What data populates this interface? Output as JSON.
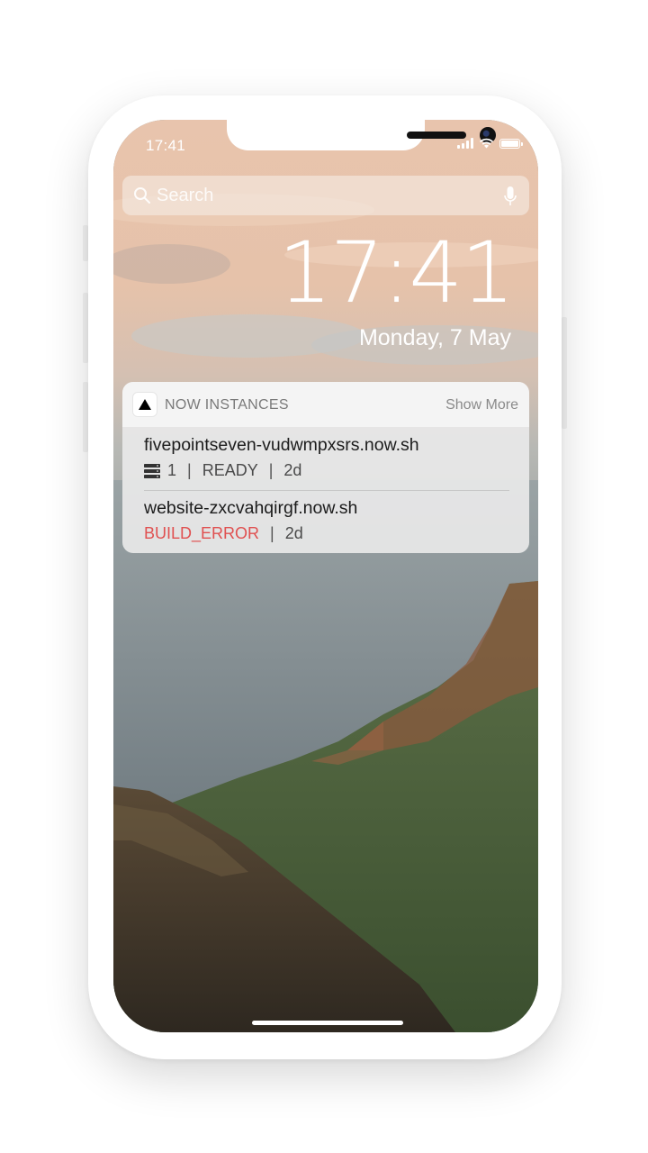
{
  "status_bar": {
    "time": "17:41"
  },
  "search": {
    "placeholder": "Search"
  },
  "lockscreen": {
    "clock": "17:41",
    "date": "Monday, 7 May"
  },
  "notification": {
    "app_name": "NOW INSTANCES",
    "show_more": "Show More",
    "items": [
      {
        "title": "fivepointseven-vudwmpxsrs.now.sh",
        "instances": "1",
        "status": "READY",
        "age": "2d",
        "separator": "|"
      },
      {
        "title": "website-zxcvahqirgf.now.sh",
        "status": "BUILD_ERROR",
        "age": "2d",
        "separator": "|"
      }
    ]
  },
  "icons": {
    "status": [
      "signal-icon",
      "wifi-icon",
      "battery-icon"
    ],
    "search": "search-icon",
    "mic": "microphone-icon",
    "app": "triangle-logo-icon",
    "instances": "server-icon"
  },
  "colors": {
    "error": "#e05050",
    "text": "#ffffff"
  }
}
